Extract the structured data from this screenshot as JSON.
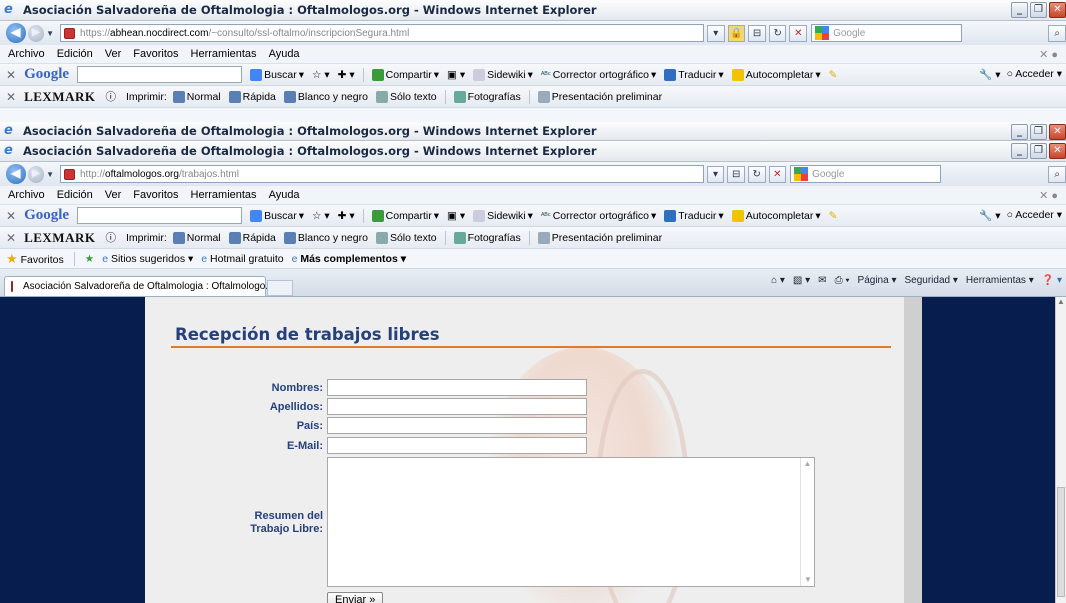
{
  "window1": {
    "title": "Asociación Salvadoreña de Oftalmologia : Oftalmologos.org - Windows Internet Explorer",
    "url_scheme": "https://",
    "url_host": "abhean.nocdirect.com",
    "url_path": "/~consulto/ssl-oftalmo/inscripcionSegura.html"
  },
  "window2": {
    "title": "Asociación Salvadoreña de Oftalmologia : Oftalmologos.org - Windows Internet Explorer"
  },
  "window3": {
    "title": "Asociación Salvadoreña de Oftalmologia : Oftalmologos.org - Windows Internet Explorer",
    "url_scheme": "http://",
    "url_host": "oftalmologos.org",
    "url_path": "/trabajos.html"
  },
  "search_placeholder": "Google",
  "menu": [
    "Archivo",
    "Edición",
    "Ver",
    "Favoritos",
    "Herramientas",
    "Ayuda"
  ],
  "google_toolbar": {
    "logo": "Google",
    "items": [
      "Buscar",
      "Compartir",
      "Sidewiki",
      "Corrector ortográfico",
      "Traducir",
      "Autocompletar"
    ],
    "acceder": "Acceder"
  },
  "lexmark_toolbar": {
    "logo": "LEXMARK",
    "imprimir": "Imprimir:",
    "items": [
      "Normal",
      "Rápida",
      "Blanco y negro",
      "Sólo texto",
      "Fotografías",
      "Presentación preliminar"
    ]
  },
  "favorites_bar": {
    "favoritos": "Favoritos",
    "sitios": "Sitios sugeridos",
    "hotmail": "Hotmail gratuito",
    "complementos": "Más complementos"
  },
  "tab": {
    "label": "Asociación Salvadoreña de Oftalmologia : Oftalmologo..."
  },
  "command_bar": {
    "pagina": "Página",
    "seguridad": "Seguridad",
    "herramientas": "Herramientas"
  },
  "form": {
    "heading": "Recepción de trabajos libres",
    "fields": [
      {
        "label": "Nombres:",
        "value": ""
      },
      {
        "label": "Apellidos:",
        "value": ""
      },
      {
        "label": "País:",
        "value": ""
      },
      {
        "label": "E-Mail:",
        "value": ""
      }
    ],
    "resumen_label_1": "Resumen del",
    "resumen_label_2": "Trabajo Libre:",
    "submit": "Enviar »"
  },
  "colors": {
    "page_background": "#071d4e",
    "heading": "#25407d",
    "rule": "#e07a28"
  }
}
